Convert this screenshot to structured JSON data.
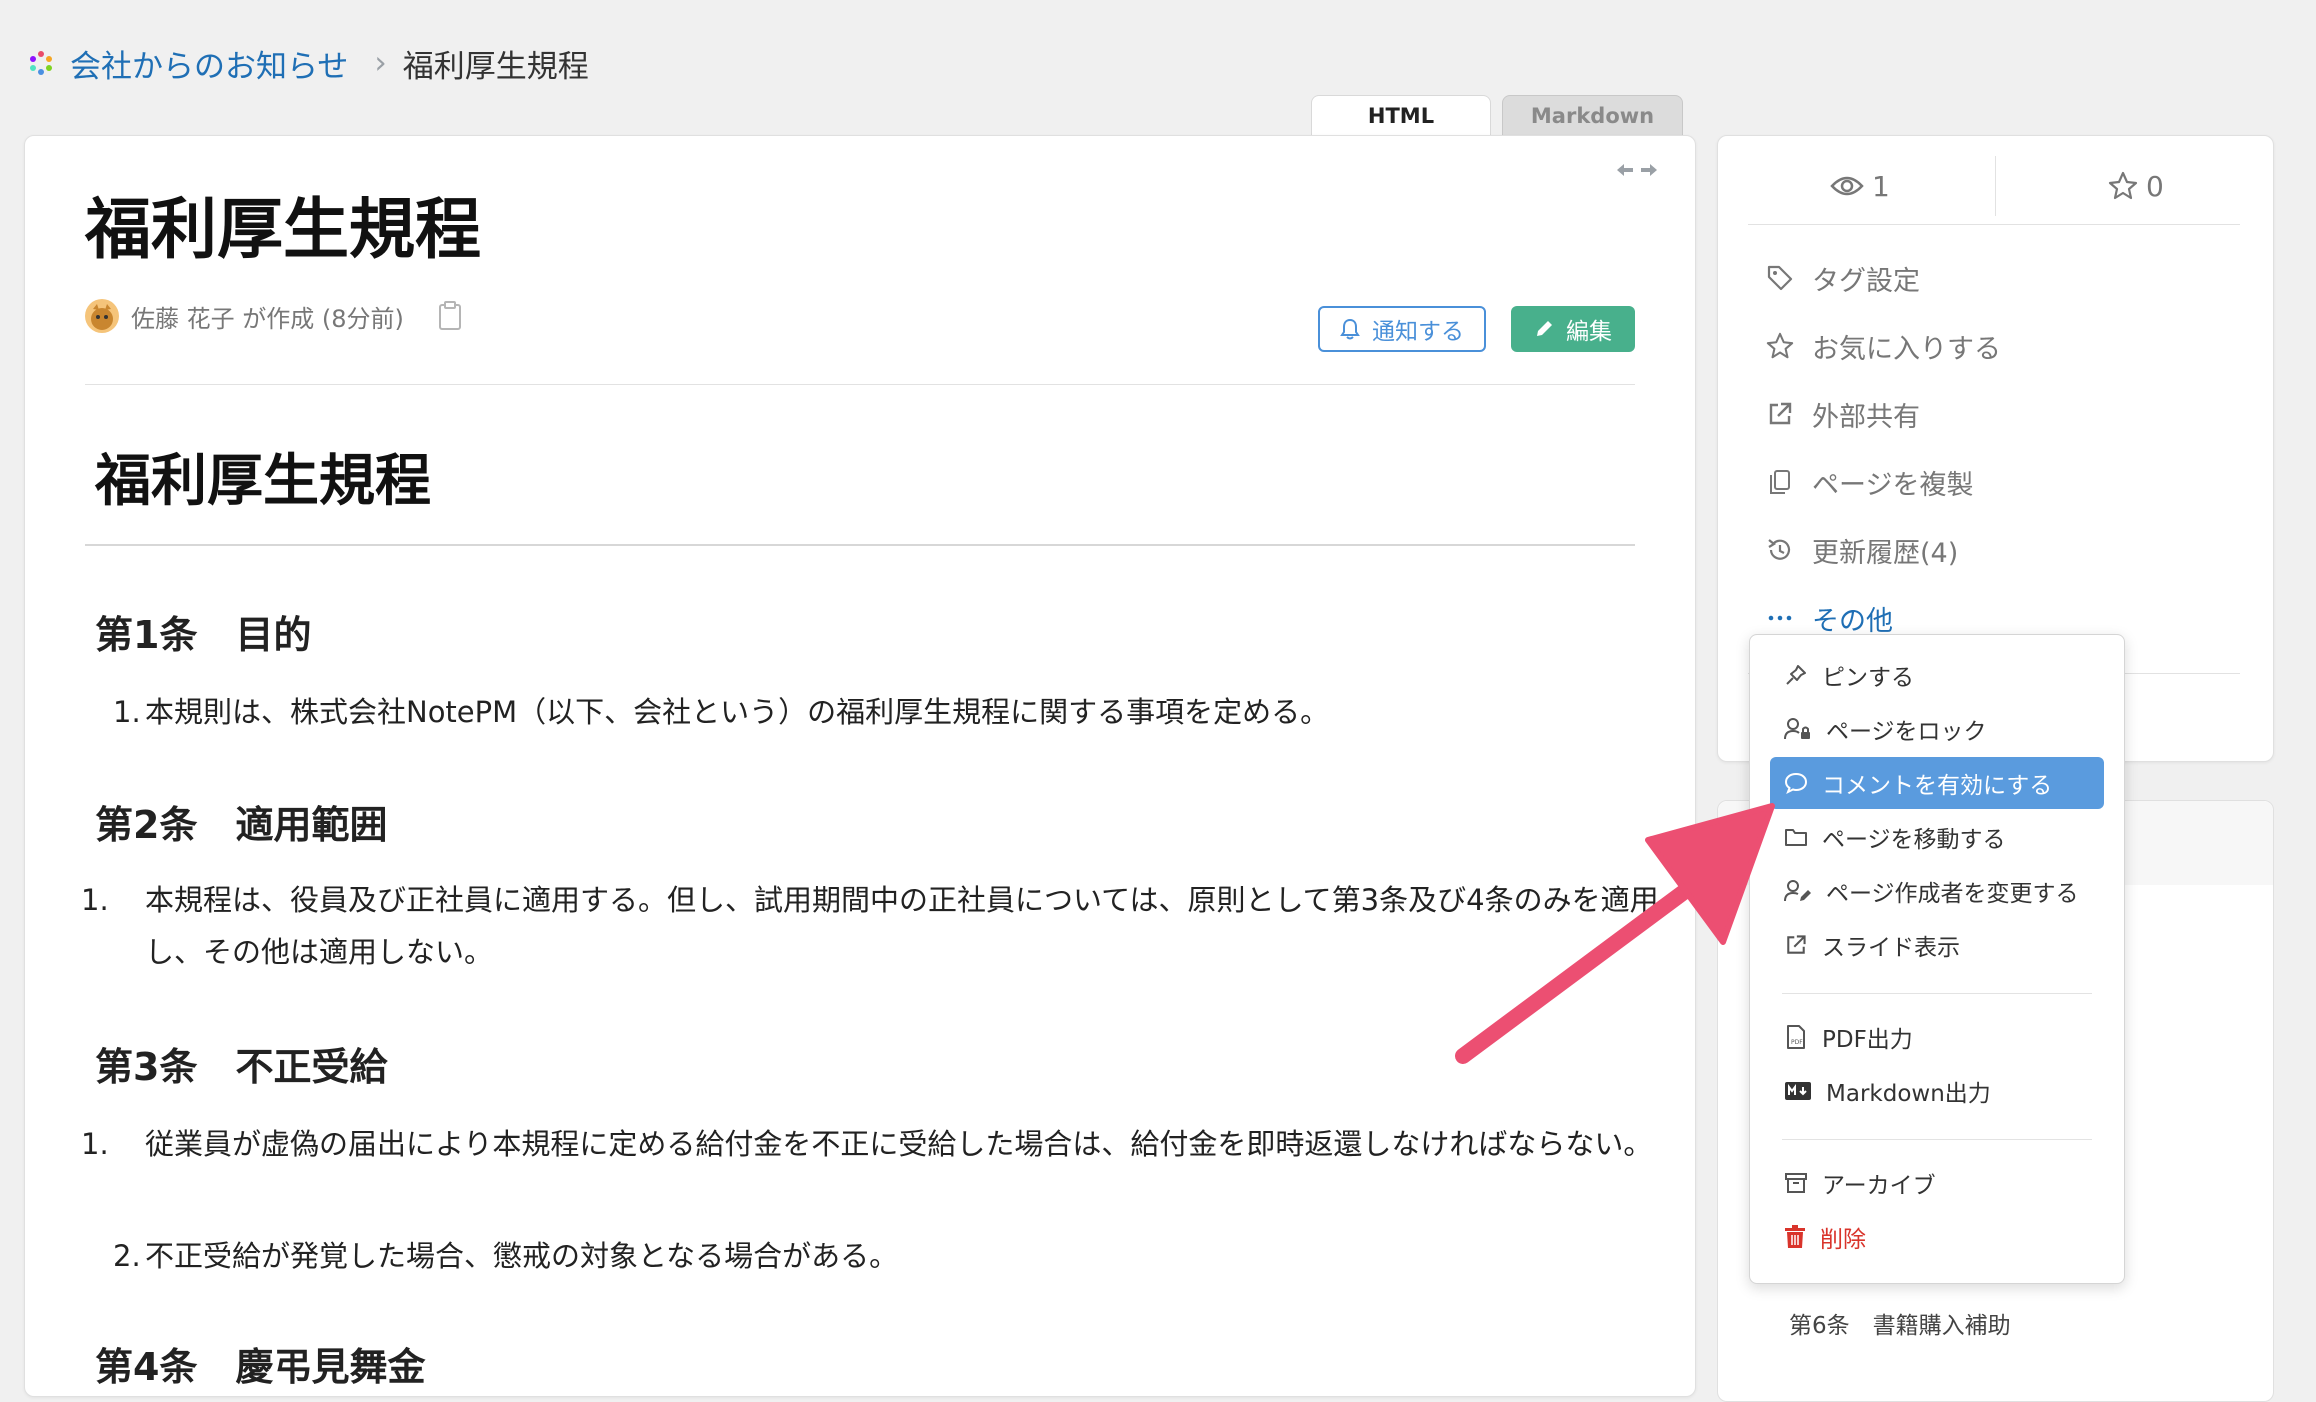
{
  "breadcrumb": {
    "parent": "会社からのお知らせ",
    "separator": "›",
    "current": "福利厚生規程"
  },
  "view_tabs": {
    "html": "HTML",
    "markdown": "Markdown",
    "active": "HTML"
  },
  "page": {
    "title": "福利厚生規程",
    "author": "佐藤 花子 が作成 (8分前)",
    "notify_button": "通知する",
    "edit_button": "編集"
  },
  "document": {
    "heading": "福利厚生規程",
    "sections": [
      {
        "title": "第1条　目的",
        "items": [
          {
            "num": "1.",
            "text": "本規則は、株式会社NotePM（以下、会社という）の福利厚生規程に関する事項を定める。"
          }
        ]
      },
      {
        "title": "第2条　適用範囲",
        "items": [
          {
            "num": "1.",
            "text": "本規程は、役員及び正社員に適用する。但し、試用期間中の正社員については、原則として第3条及び4条のみを適用し、その他は適用しない。"
          }
        ]
      },
      {
        "title": "第3条　不正受給",
        "items": [
          {
            "num": "1.",
            "text": "従業員が虚偽の届出により本規程に定める給付金を不正に受給した場合は、給付金を即時返還しなければならない。"
          },
          {
            "num": "2.",
            "text": "不正受給が発覚した場合、懲戒の対象となる場合がある。"
          }
        ]
      },
      {
        "title": "第4条　慶弔見舞金"
      }
    ]
  },
  "sidebar": {
    "views": "1",
    "stars": "0",
    "items": [
      {
        "label": "タグ設定",
        "icon": "tag-icon"
      },
      {
        "label": "お気に入りする",
        "icon": "star-icon"
      },
      {
        "label": "外部共有",
        "icon": "external-link-icon"
      },
      {
        "label": "ページを複製",
        "icon": "copy-icon"
      },
      {
        "label": "更新履歴(4)",
        "icon": "history-icon"
      },
      {
        "label": "その他",
        "icon": "ellipsis-icon"
      }
    ],
    "toc_item": "第6条　書籍購入補助"
  },
  "dropdown": {
    "items": [
      {
        "label": "ピンする",
        "icon": "pin-icon"
      },
      {
        "label": "ページをロック",
        "icon": "user-lock-icon"
      },
      {
        "label": "コメントを有効にする",
        "icon": "comment-icon",
        "highlighted": true
      },
      {
        "label": "ページを移動する",
        "icon": "folder-icon"
      },
      {
        "label": "ページ作成者を変更する",
        "icon": "user-edit-icon"
      },
      {
        "label": "スライド表示",
        "icon": "external-link-icon"
      },
      {
        "label": "PDF出力",
        "icon": "pdf-icon"
      },
      {
        "label": "Markdown出力",
        "icon": "markdown-icon"
      },
      {
        "label": "アーカイブ",
        "icon": "archive-icon"
      },
      {
        "label": "削除",
        "icon": "trash-icon",
        "danger": true
      }
    ]
  },
  "colors": {
    "link": "#1f6fb5",
    "edit_button": "#48b08c",
    "notify_border": "#4a90d9",
    "highlight": "#5a9bde",
    "danger": "#d9342b",
    "annotation_arrow": "#ec4f72"
  }
}
